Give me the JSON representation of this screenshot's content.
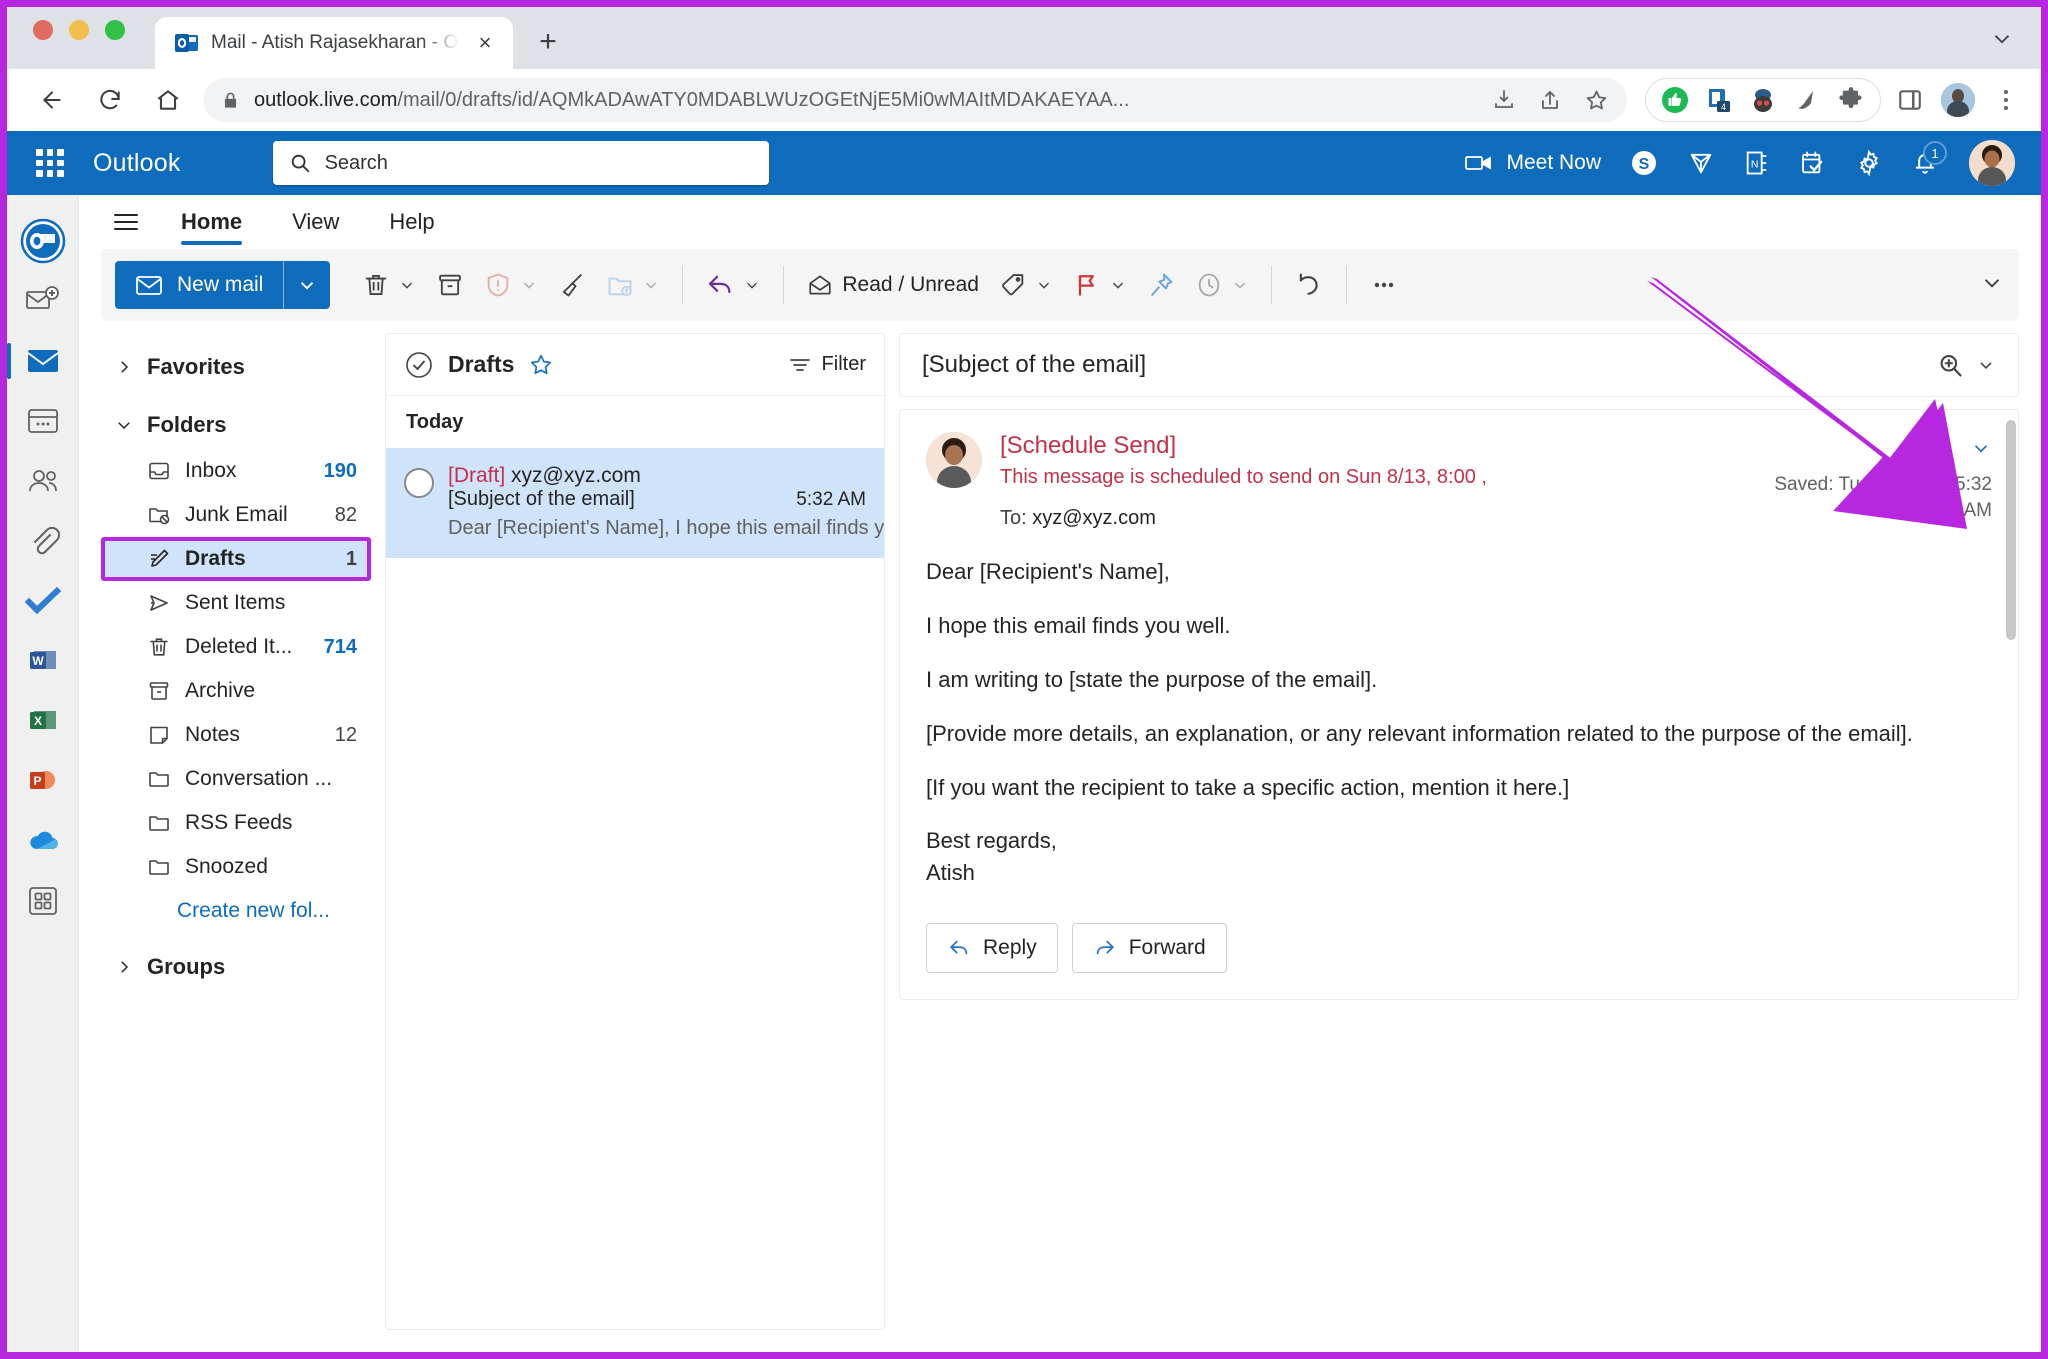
{
  "browser": {
    "tab": {
      "title": "Mail - Atish Rajasekharan - Out",
      "favicon": "outlook-icon",
      "close": "×"
    },
    "new_tab_label": "+",
    "nav": {
      "back": "back-icon",
      "forward": "forward-icon",
      "reload": "reload-icon",
      "home": "home-icon"
    },
    "omnibox": {
      "lock": "lock-icon",
      "url_domain": "outlook.live.com",
      "url_path": "/mail/0/drafts/id/AQMkADAwATY0MDABLWUzOGEtNjE5Mi0wMAItMDAKAEYAA...",
      "download_icon": "download-icon",
      "share_icon": "share-icon",
      "bookmark_icon": "star-icon"
    },
    "extensions": [
      {
        "name": "thumbs-up-extension-icon",
        "badge": ""
      },
      {
        "name": "pocket-extension-icon",
        "badge": "4"
      },
      {
        "name": "avatar-extension-icon",
        "badge": ""
      },
      {
        "name": "paint-extension-icon",
        "badge": ""
      },
      {
        "name": "puzzle-extensions-icon",
        "badge": ""
      }
    ],
    "side_panel_icon": "side-panel-icon",
    "profile_icon": "profile-avatar",
    "menu_icon": "kebab-menu-icon"
  },
  "outlook": {
    "waffle_icon": "app-launcher-icon",
    "brand": "Outlook",
    "search": {
      "placeholder": "Search",
      "icon": "search-icon"
    },
    "topbar_right": [
      {
        "name": "meet-now",
        "icon": "video-camera-icon",
        "label": "Meet Now"
      },
      {
        "name": "skype",
        "icon": "skype-icon",
        "label": ""
      },
      {
        "name": "diamond",
        "icon": "diamond-icon",
        "label": ""
      },
      {
        "name": "onenote",
        "icon": "onenote-icon",
        "label": ""
      },
      {
        "name": "to-do",
        "icon": "calendar-check-icon",
        "label": ""
      },
      {
        "name": "settings",
        "icon": "gear-icon",
        "label": ""
      },
      {
        "name": "notifications",
        "icon": "bell-icon",
        "label": "",
        "badge": "1"
      }
    ],
    "account_avatar": "account-avatar",
    "rail": [
      {
        "name": "outlook-logo",
        "icon": "outlook-icon",
        "active": false
      },
      {
        "name": "new-mail",
        "icon": "new-mail-icon",
        "active": false
      },
      {
        "name": "mail",
        "icon": "mail-icon",
        "active": true
      },
      {
        "name": "calendar",
        "icon": "calendar-icon",
        "active": false
      },
      {
        "name": "people",
        "icon": "people-icon",
        "active": false
      },
      {
        "name": "files",
        "icon": "paperclip-icon",
        "active": false
      },
      {
        "name": "to-do",
        "icon": "checkmark-icon",
        "active": false
      },
      {
        "name": "word",
        "icon": "word-icon",
        "active": false
      },
      {
        "name": "excel",
        "icon": "excel-icon",
        "active": false
      },
      {
        "name": "powerpoint",
        "icon": "powerpoint-icon",
        "active": false
      },
      {
        "name": "onedrive",
        "icon": "onedrive-icon",
        "active": false
      },
      {
        "name": "all-apps",
        "icon": "grid-apps-icon",
        "active": false
      }
    ],
    "ribbon_tabs": [
      {
        "label": "Home",
        "active": true
      },
      {
        "label": "View",
        "active": false
      },
      {
        "label": "Help",
        "active": false
      }
    ],
    "ribbon": {
      "new_mail_label": "New mail",
      "new_mail_icon": "envelope-icon",
      "buttons": [
        {
          "name": "delete",
          "icon": "trash-icon",
          "label": "",
          "caret": true,
          "disabled": false
        },
        {
          "name": "archive",
          "icon": "archive-icon",
          "label": "",
          "caret": false,
          "disabled": false
        },
        {
          "name": "report",
          "icon": "shield-warning-icon",
          "label": "",
          "caret": true,
          "disabled": true
        },
        {
          "name": "sweep",
          "icon": "broom-icon",
          "label": "",
          "caret": false,
          "disabled": false
        },
        {
          "name": "move-to",
          "icon": "move-folder-icon",
          "label": "",
          "caret": true,
          "disabled": true
        },
        {
          "name": "reply",
          "icon": "reply-arrow-icon",
          "label": "",
          "caret": true,
          "disabled": false
        },
        {
          "name": "read-unread",
          "icon": "open-envelope-icon",
          "label": "Read / Unread",
          "caret": false,
          "disabled": false
        },
        {
          "name": "categorize",
          "icon": "tag-icon",
          "label": "",
          "caret": true,
          "disabled": false
        },
        {
          "name": "flag",
          "icon": "flag-icon",
          "label": "",
          "caret": true,
          "disabled": false
        },
        {
          "name": "pin",
          "icon": "pin-icon",
          "label": "",
          "caret": false,
          "disabled": false
        },
        {
          "name": "snooze",
          "icon": "clock-icon",
          "label": "",
          "caret": true,
          "disabled": true
        },
        {
          "name": "undo",
          "icon": "undo-icon",
          "label": "",
          "caret": false,
          "disabled": false
        },
        {
          "name": "more-options",
          "icon": "ellipsis-icon",
          "label": "",
          "caret": false,
          "disabled": false
        }
      ]
    },
    "folders": {
      "favorites": {
        "label": "Favorites",
        "expanded": false
      },
      "folders_label": "Folders",
      "folders_expanded": true,
      "items": [
        {
          "label": "Inbox",
          "count": "190",
          "icon": "inbox-icon",
          "selected": false,
          "count_style": "blue"
        },
        {
          "label": "Junk Email",
          "count": "82",
          "icon": "junk-folder-icon",
          "selected": false,
          "count_style": "plain"
        },
        {
          "label": "Drafts",
          "count": "1",
          "icon": "drafts-pencil-icon",
          "selected": true,
          "count_style": "plain"
        },
        {
          "label": "Sent Items",
          "count": "",
          "icon": "sent-icon",
          "selected": false,
          "count_style": "plain"
        },
        {
          "label": "Deleted It...",
          "count": "714",
          "icon": "trash-icon",
          "selected": false,
          "count_style": "blue"
        },
        {
          "label": "Archive",
          "count": "",
          "icon": "archive-icon",
          "selected": false,
          "count_style": "plain"
        },
        {
          "label": "Notes",
          "count": "12",
          "icon": "note-icon",
          "selected": false,
          "count_style": "plain"
        },
        {
          "label": "Conversation ...",
          "count": "",
          "icon": "folder-icon",
          "selected": false,
          "count_style": "plain"
        },
        {
          "label": "RSS Feeds",
          "count": "",
          "icon": "folder-icon",
          "selected": false,
          "count_style": "plain"
        },
        {
          "label": "Snoozed",
          "count": "",
          "icon": "folder-icon",
          "selected": false,
          "count_style": "plain"
        }
      ],
      "create_new_folder": "Create new fol...",
      "groups": {
        "label": "Groups",
        "expanded": false
      }
    },
    "message_list": {
      "select_all_icon": "select-all-icon",
      "title": "Drafts",
      "favorite_icon": "star-outline-icon",
      "filter_label": "Filter",
      "filter_icon": "filter-icon",
      "day_group": "Today",
      "messages": [
        {
          "draft_tag": "[Draft]",
          "sender": "xyz@xyz.com",
          "subject": "[Subject of the email]",
          "time": "5:32 AM",
          "preview": "Dear [Recipient's Name], I hope this email finds you ...",
          "selected": true
        }
      ]
    },
    "reading_pane": {
      "subject": "[Subject of the email]",
      "zoom_icon": "zoom-in-icon",
      "schedule_title": "[Schedule Send]",
      "schedule_note": "This message is scheduled to send on Sun 8/13, 8:00 ,",
      "to_label": "To:",
      "to_value": "xyz@xyz.com",
      "edit_icon": "pencil-edit-icon",
      "more_caret_icon": "chevron-down-icon",
      "saved_text": "Saved: Tue 8/8/2023 5:32 AM",
      "body": [
        "Dear [Recipient's Name],",
        "I hope this email finds you well.",
        "I am writing to [state the purpose of the email].",
        "[Provide more details, an explanation, or any relevant information related to the purpose of the email].",
        "[If you want the recipient to take a specific action, mention it here.]"
      ],
      "signoff": [
        "Best regards,",
        "Atish"
      ],
      "reply_label": "Reply",
      "reply_icon": "reply-arrow-icon",
      "forward_label": "Forward",
      "forward_icon": "forward-arrow-icon"
    }
  },
  "annotations": {
    "arrow_color": "#b827e0",
    "border_color": "#b827e0",
    "highlight_target": "Drafts"
  }
}
